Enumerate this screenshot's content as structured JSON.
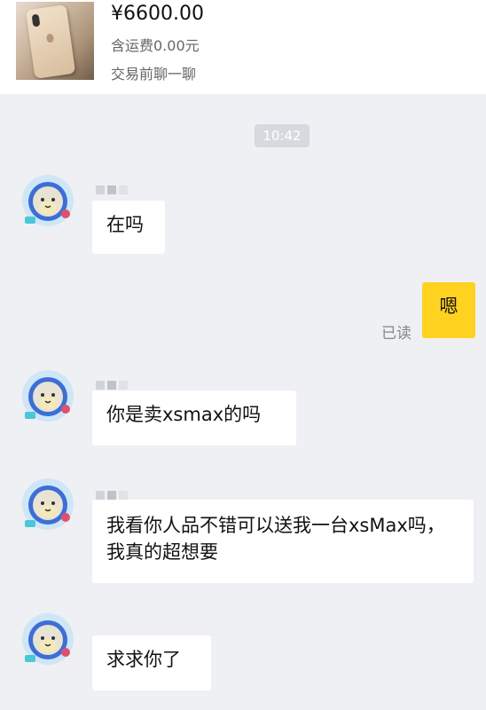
{
  "product": {
    "price": "¥6600.00",
    "shipping": "含运费0.00元",
    "chat_prompt": "交易前聊一聊"
  },
  "timestamp": "10:42",
  "messages": [
    {
      "from": "other",
      "text": "在吗"
    },
    {
      "from": "me",
      "text": "嗯",
      "status": "已读"
    },
    {
      "from": "other",
      "text": "你是卖xsmax的吗"
    },
    {
      "from": "other",
      "text": "我看你人品不错可以送我一台xsMax吗，我真的超想要"
    },
    {
      "from": "other",
      "text": "求求你了"
    }
  ],
  "colors": {
    "background": "#eef0f3",
    "my_bubble": "#ffd21f",
    "other_bubble": "#ffffff"
  },
  "icons": {
    "avatar": "seal-avatar-icon",
    "product": "iphone-xs-max-gold-photo"
  }
}
